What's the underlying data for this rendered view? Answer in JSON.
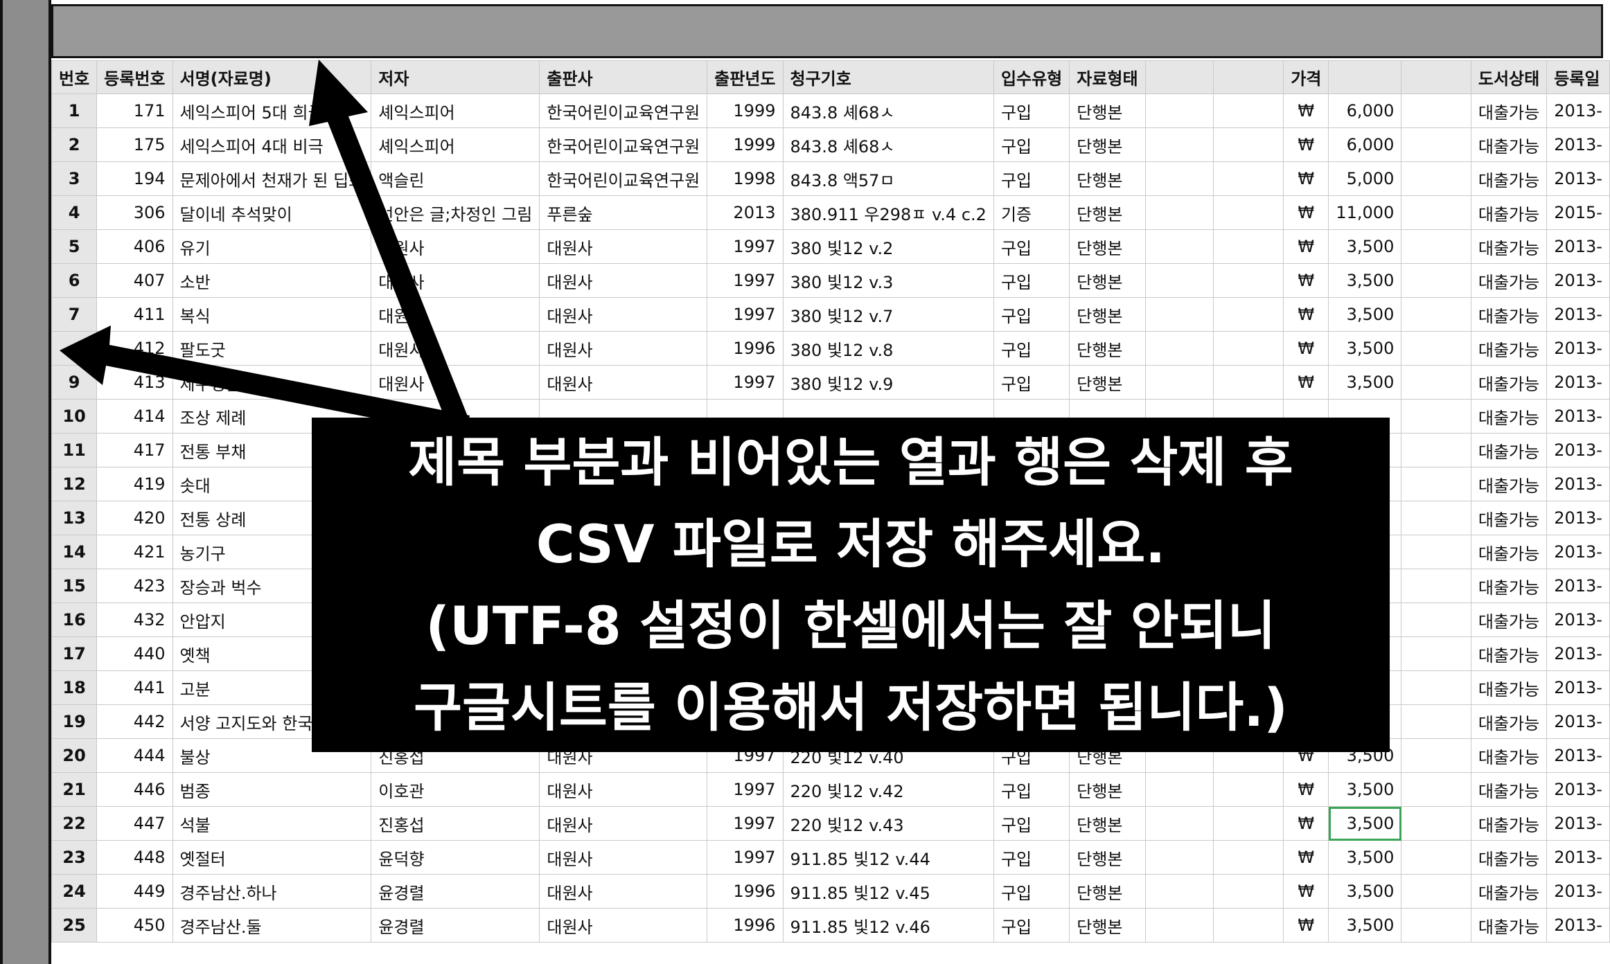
{
  "columns": [
    "번호",
    "등록번호",
    "서명(자료명)",
    "저자",
    "출판사",
    "출판년도",
    "청구기호",
    "입수유형",
    "자료형태",
    "",
    "",
    "가격",
    "",
    "",
    "도서상태",
    "등록일"
  ],
  "rows": [
    {
      "n": "1",
      "reg": "171",
      "title": "세익스피어 5대 희극",
      "author": "셰익스피어",
      "pub": "한국어린이교육연구원",
      "year": "1999",
      "call": "843.8 셰68ㅅ",
      "acq": "구입",
      "form": "단행본",
      "cur": "₩",
      "price": "6,000",
      "status": "대출가능",
      "date": "2013-"
    },
    {
      "n": "2",
      "reg": "175",
      "title": "세익스피어 4대 비극",
      "author": "셰익스피어",
      "pub": "한국어린이교육연구원",
      "year": "1999",
      "call": "843.8 셰68ㅅ",
      "acq": "구입",
      "form": "단행본",
      "cur": "₩",
      "price": "6,000",
      "status": "대출가능",
      "date": "2013-"
    },
    {
      "n": "3",
      "reg": "194",
      "title": "문제아에서 천재가 된 딥스",
      "author": "액슬린",
      "pub": "한국어린이교육연구원",
      "year": "1998",
      "call": "843.8 액57ㅁ",
      "acq": "구입",
      "form": "단행본",
      "cur": "₩",
      "price": "5,000",
      "status": "대출가능",
      "date": "2013-"
    },
    {
      "n": "4",
      "reg": "306",
      "title": "달이네 추석맞이",
      "author": "선안은 글;차정인 그림",
      "pub": "푸른숲",
      "year": "2013",
      "call": "380.911 우298ㅍ v.4 c.2",
      "acq": "기증",
      "form": "단행본",
      "cur": "₩",
      "price": "11,000",
      "status": "대출가능",
      "date": "2015-"
    },
    {
      "n": "5",
      "reg": "406",
      "title": "유기",
      "author": "대원사",
      "pub": "대원사",
      "year": "1997",
      "call": "380 빛12 v.2",
      "acq": "구입",
      "form": "단행본",
      "cur": "₩",
      "price": "3,500",
      "status": "대출가능",
      "date": "2013-"
    },
    {
      "n": "6",
      "reg": "407",
      "title": "소반",
      "author": "대원사",
      "pub": "대원사",
      "year": "1997",
      "call": "380 빛12 v.3",
      "acq": "구입",
      "form": "단행본",
      "cur": "₩",
      "price": "3,500",
      "status": "대출가능",
      "date": "2013-"
    },
    {
      "n": "7",
      "reg": "411",
      "title": "복식",
      "author": "대원사",
      "pub": "대원사",
      "year": "1997",
      "call": "380 빛12 v.7",
      "acq": "구입",
      "form": "단행본",
      "cur": "₩",
      "price": "3,500",
      "status": "대출가능",
      "date": "2013-"
    },
    {
      "n": "",
      "reg": "412",
      "title": "팔도굿",
      "author": "대원사",
      "pub": "대원사",
      "year": "1996",
      "call": "380 빛12 v.8",
      "acq": "구입",
      "form": "단행본",
      "cur": "₩",
      "price": "3,500",
      "status": "대출가능",
      "date": "2013-"
    },
    {
      "n": "9",
      "reg": "413",
      "title": "제주성읍마을",
      "author": "대원사",
      "pub": "대원사",
      "year": "1997",
      "call": "380 빛12 v.9",
      "acq": "구입",
      "form": "단행본",
      "cur": "₩",
      "price": "3,500",
      "status": "대출가능",
      "date": "2013-"
    },
    {
      "n": "10",
      "reg": "414",
      "title": "조상 제례",
      "author": "",
      "pub": "",
      "year": "",
      "call": "",
      "acq": "",
      "form": "",
      "cur": "",
      "price": "",
      "status": "대출가능",
      "date": "2013-"
    },
    {
      "n": "11",
      "reg": "417",
      "title": "전통 부채",
      "author": "",
      "pub": "",
      "year": "",
      "call": "",
      "acq": "",
      "form": "",
      "cur": "",
      "price": "",
      "status": "대출가능",
      "date": "2013-"
    },
    {
      "n": "12",
      "reg": "419",
      "title": "솟대",
      "author": "",
      "pub": "",
      "year": "",
      "call": "",
      "acq": "",
      "form": "",
      "cur": "",
      "price": "",
      "status": "대출가능",
      "date": "2013-"
    },
    {
      "n": "13",
      "reg": "420",
      "title": "전통 상례",
      "author": "",
      "pub": "",
      "year": "",
      "call": "",
      "acq": "",
      "form": "",
      "cur": "",
      "price": "",
      "status": "대출가능",
      "date": "2013-"
    },
    {
      "n": "14",
      "reg": "421",
      "title": "농기구",
      "author": "",
      "pub": "",
      "year": "",
      "call": "",
      "acq": "",
      "form": "",
      "cur": "",
      "price": "",
      "status": "대출가능",
      "date": "2013-"
    },
    {
      "n": "15",
      "reg": "423",
      "title": "장승과 벅수",
      "author": "",
      "pub": "",
      "year": "",
      "call": "",
      "acq": "",
      "form": "",
      "cur": "",
      "price": "",
      "status": "대출가능",
      "date": "2013-"
    },
    {
      "n": "16",
      "reg": "432",
      "title": "안압지",
      "author": "",
      "pub": "",
      "year": "",
      "call": "",
      "acq": "",
      "form": "",
      "cur": "",
      "price": "",
      "status": "대출가능",
      "date": "2013-"
    },
    {
      "n": "17",
      "reg": "440",
      "title": "옛책",
      "author": "",
      "pub": "",
      "year": "",
      "call": "",
      "acq": "",
      "form": "",
      "cur": "",
      "price": "",
      "status": "대출가능",
      "date": "2013-"
    },
    {
      "n": "18",
      "reg": "441",
      "title": "고분",
      "author": "",
      "pub": "",
      "year": "",
      "call": "",
      "acq": "",
      "form": "",
      "cur": "",
      "price": "",
      "status": "대출가능",
      "date": "2013-"
    },
    {
      "n": "19",
      "reg": "442",
      "title": "서양 고지도와 한국",
      "author": "",
      "pub": "",
      "year": "",
      "call": "",
      "acq": "",
      "form": "",
      "cur": "",
      "price": "",
      "status": "대출가능",
      "date": "2013-"
    },
    {
      "n": "20",
      "reg": "444",
      "title": "불상",
      "author": "진홍섭",
      "pub": "대원사",
      "year": "1997",
      "call": "220 빛12 v.40",
      "acq": "구입",
      "form": "단행본",
      "cur": "₩",
      "price": "3,500",
      "status": "대출가능",
      "date": "2013-"
    },
    {
      "n": "21",
      "reg": "446",
      "title": "범종",
      "author": "이호관",
      "pub": "대원사",
      "year": "1997",
      "call": "220 빛12 v.42",
      "acq": "구입",
      "form": "단행본",
      "cur": "₩",
      "price": "3,500",
      "status": "대출가능",
      "date": "2013-"
    },
    {
      "n": "22",
      "reg": "447",
      "title": "석불",
      "author": "진홍섭",
      "pub": "대원사",
      "year": "1997",
      "call": "220 빛12 v.43",
      "acq": "구입",
      "form": "단행본",
      "cur": "₩",
      "price": "3,500",
      "status": "대출가능",
      "date": "2013-"
    },
    {
      "n": "23",
      "reg": "448",
      "title": "옛절터",
      "author": "윤덕향",
      "pub": "대원사",
      "year": "1997",
      "call": "911.85 빛12 v.44",
      "acq": "구입",
      "form": "단행본",
      "cur": "₩",
      "price": "3,500",
      "status": "대출가능",
      "date": "2013-"
    },
    {
      "n": "24",
      "reg": "449",
      "title": "경주남산.하나",
      "author": "윤경렬",
      "pub": "대원사",
      "year": "1996",
      "call": "911.85 빛12 v.45",
      "acq": "구입",
      "form": "단행본",
      "cur": "₩",
      "price": "3,500",
      "status": "대출가능",
      "date": "2013-"
    },
    {
      "n": "25",
      "reg": "450",
      "title": "경주남산.둘",
      "author": "윤경렬",
      "pub": "대원사",
      "year": "1996",
      "call": "911.85 빛12 v.46",
      "acq": "구입",
      "form": "단행본",
      "cur": "₩",
      "price": "3,500",
      "status": "대출가능",
      "date": "2013-"
    }
  ],
  "selected_cell": {
    "row": 22,
    "column": "가격"
  },
  "overlay": {
    "lines": [
      "제목 부분과 비어있는 열과 행은 삭제 후",
      "CSV 파일로 저장 해주세요.",
      "(UTF-8 설정이 한셀에서는 잘 안되니",
      "구글시트를 이용해서 저장하면 됩니다.)"
    ]
  },
  "colors": {
    "header_bg": "#e6e6e6",
    "side_bar": "#8d8d8d",
    "top_band": "#999999",
    "selection": "#3aa655",
    "overlay_bg": "#000000"
  }
}
